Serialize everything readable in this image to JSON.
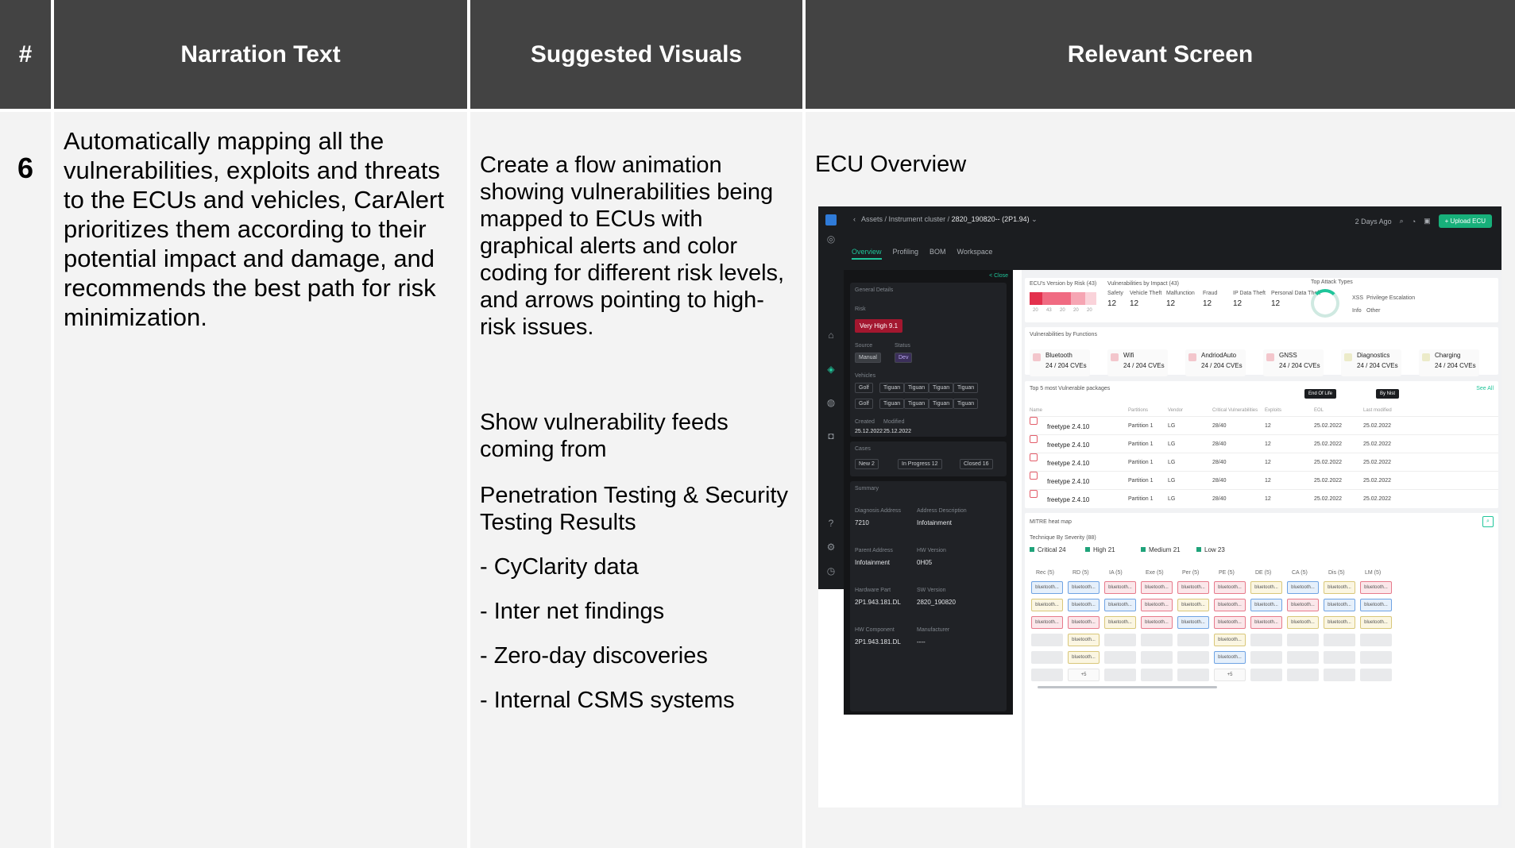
{
  "headers": {
    "num": "#",
    "narration": "Narration Text",
    "visuals": "Suggested Visuals",
    "screen": "Relevant Screen"
  },
  "row": {
    "num": "6",
    "narration": "Automatically mapping all the vulnerabilities, exploits and threats to the ECUs and vehicles, CarAlert prioritizes them according to their potential impact and damage, and recommends the best path for risk minimization.",
    "visuals": {
      "p1": "Create a flow animation showing vulnerabilities being mapped to ECUs with graphical alerts and color coding for different risk levels, and arrows pointing to high-risk issues.",
      "p2": "Show vulnerability feeds coming from",
      "p3": "Penetration Testing & Security Testing Results",
      "p4": "- CyClarity data",
      "p5": "- Inter net findings",
      "p6": "- Zero-day discoveries",
      "p7": "- Internal CSMS systems"
    },
    "screen_title": "ECU Overview"
  },
  "app": {
    "crumbs": {
      "assets": "Assets",
      "cluster": "Instrument cluster",
      "version": "2820_190820-- (2P1.94)"
    },
    "updated": "2 Days Ago",
    "upload": "+ Upload ECU",
    "tabs": [
      "Overview",
      "Profiling",
      "BOM",
      "Workspace"
    ],
    "left": {
      "close": "< Close",
      "general": "General Details",
      "risk_label": "Risk",
      "risk_value": "Very High 9.1",
      "source_label": "Source",
      "status_label": "Status",
      "source_value": "Manual",
      "status_value": "Dev",
      "vehicles_label": "Vehicles",
      "vehicles_row1": [
        "Golf",
        "Tiguan",
        "Tiguan",
        "Tiguan",
        "Tiguan"
      ],
      "vehicles_row2": [
        "Golf",
        "Tiguan",
        "Tiguan",
        "Tiguan",
        "Tiguan"
      ],
      "created_label": "Created",
      "modified_label": "Modified",
      "created": "25.12.2022",
      "modified": "25.12.2022",
      "cases_label": "Cases",
      "cases_new": "New 2",
      "cases_progress": "In Progress 12",
      "cases_closed": "Closed 16",
      "summary": "Summary",
      "diag_label": "Diagnosis Address",
      "diag": "7210",
      "addr_label": "Address Description",
      "addr": "Infotainment",
      "parent_label": "Parent Address",
      "parent": "Infotainment",
      "hw_label": "HW Version",
      "hw": "0H05",
      "part_label": "Hardware Part",
      "part": "2P1.943.181.DL",
      "sw_label": "SW Version",
      "sw": "2820_190820",
      "comp_label": "HW Component",
      "comp": "2P1.943.181.DL",
      "manu_label": "Manufacturer",
      "manu": "----"
    },
    "risk_card": {
      "title": "ECU's Version by Risk (43)",
      "ticks": [
        "20",
        "43",
        "20",
        "20",
        "20"
      ]
    },
    "impact_card": {
      "title": "Vulnerabilities by Impact (43)",
      "items": [
        {
          "label": "Safety",
          "value": "12"
        },
        {
          "label": "Vehicle Theft",
          "value": "12"
        },
        {
          "label": "Malfunction",
          "value": "12"
        },
        {
          "label": "Fraud",
          "value": "12"
        },
        {
          "label": "IP Data Theft",
          "value": "12"
        },
        {
          "label": "Personal Data Theft",
          "value": "12"
        }
      ]
    },
    "attack_card": {
      "title": "Top Attack Types",
      "items": [
        "XSS",
        "Privilege Escalation",
        "Info",
        "Other"
      ]
    },
    "functions": {
      "title": "Vulnerabilities by Functions",
      "items": [
        {
          "name": "Bluetooth",
          "value": "24 / 204 CVEs",
          "color": "#f3c6cc"
        },
        {
          "name": "Wifi",
          "value": "24 / 204 CVEs",
          "color": "#f3c6cc"
        },
        {
          "name": "AndriodAuto",
          "value": "24 / 204 CVEs",
          "color": "#f3c6cc"
        },
        {
          "name": "GNSS",
          "value": "24 / 204 CVEs",
          "color": "#f3c6cc"
        },
        {
          "name": "Diagnostics",
          "value": "24 / 204 CVEs",
          "color": "#ecebc9"
        },
        {
          "name": "Charging",
          "value": "24 / 204 CVEs",
          "color": "#ecebc9"
        }
      ]
    },
    "packages": {
      "title": "Top 5 most Vulnerable packages",
      "see_all": "See All",
      "tip1": "End Of Life",
      "tip2": "By Nist",
      "columns": [
        "Name",
        "Partitions",
        "Vendor",
        "Critical Vulnerabilities",
        "Exploits",
        "EOL",
        "Last modified"
      ],
      "rows": [
        {
          "name": "freetype 2.4.10",
          "partition": "Partition 1",
          "vendor": "LG",
          "critical": "28/40",
          "exploits": "12",
          "eol": "25.02.2022",
          "modified": "25.02.2022"
        },
        {
          "name": "freetype 2.4.10",
          "partition": "Partition 1",
          "vendor": "LG",
          "critical": "28/40",
          "exploits": "12",
          "eol": "25.02.2022",
          "modified": "25.02.2022"
        },
        {
          "name": "freetype 2.4.10",
          "partition": "Partition 1",
          "vendor": "LG",
          "critical": "28/40",
          "exploits": "12",
          "eol": "25.02.2022",
          "modified": "25.02.2022"
        },
        {
          "name": "freetype 2.4.10",
          "partition": "Partition 1",
          "vendor": "LG",
          "critical": "28/40",
          "exploits": "12",
          "eol": "25.02.2022",
          "modified": "25.02.2022"
        },
        {
          "name": "freetype 2.4.10",
          "partition": "Partition 1",
          "vendor": "LG",
          "critical": "28/40",
          "exploits": "12",
          "eol": "25.02.2022",
          "modified": "25.02.2022"
        }
      ]
    },
    "heatmap": {
      "title": "MITRE heat map",
      "subtitle": "Technique By Severity (88)",
      "severities": [
        {
          "label": "Critical",
          "value": "24"
        },
        {
          "label": "High",
          "value": "21"
        },
        {
          "label": "Medium",
          "value": "21"
        },
        {
          "label": "Low",
          "value": "23"
        }
      ],
      "columns": [
        "Rec (5)",
        "RD (5)",
        "IA (5)",
        "Exe (5)",
        "Per (5)",
        "PE (5)",
        "DE (5)",
        "CA (5)",
        "Dis (5)",
        "LM (5)"
      ],
      "cell_text": "bluetooth...",
      "more_text": "+5"
    }
  }
}
